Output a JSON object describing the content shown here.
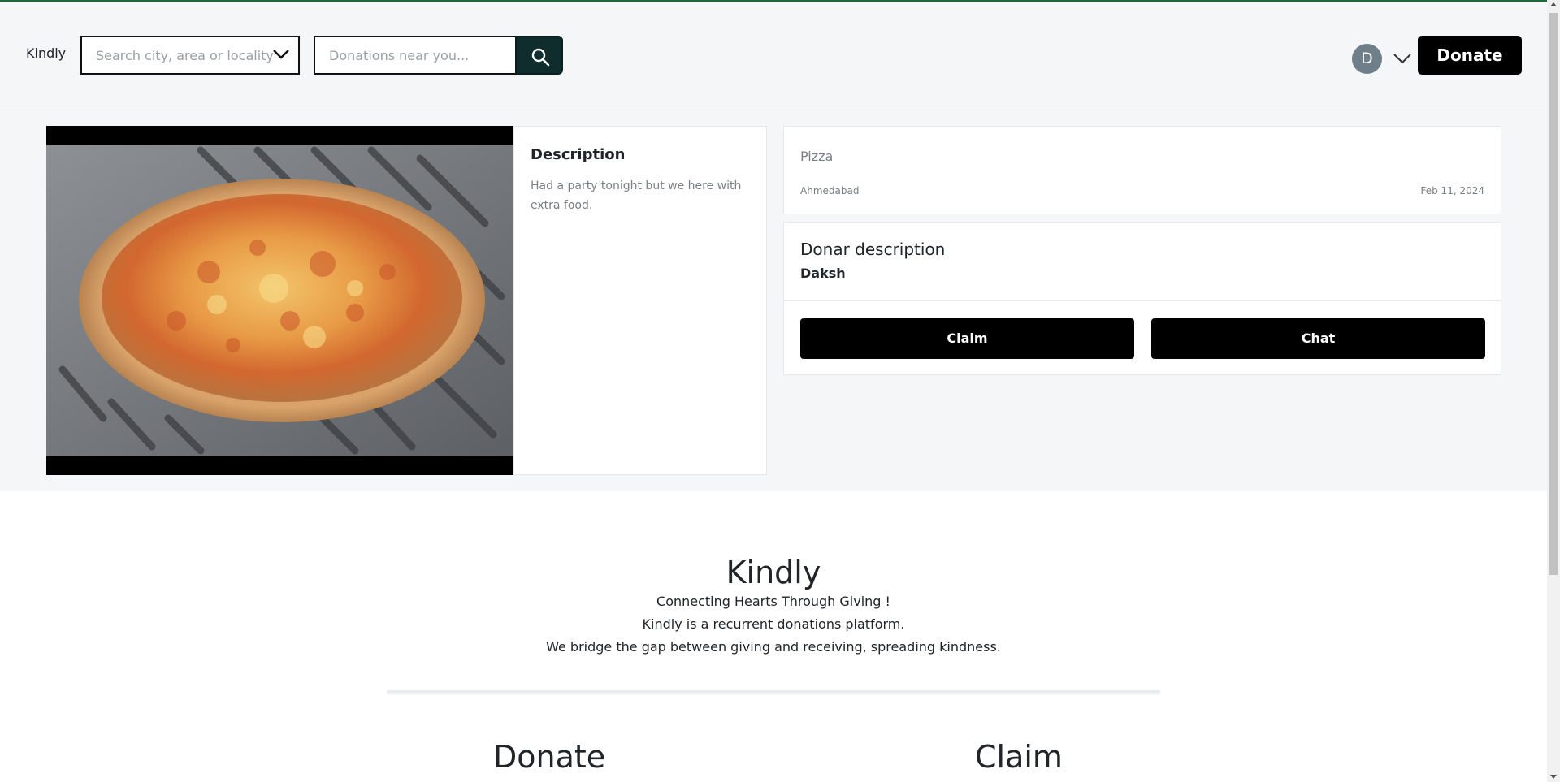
{
  "header": {
    "brand": "Kindly",
    "location_placeholder": "Search city, area or locality",
    "search_placeholder": "Donations near you...",
    "avatar_initial": "D",
    "donate_label": "Donate"
  },
  "listing": {
    "description_heading": "Description",
    "description_text": "Had a party tonight but we here with extra food.",
    "title": "Pizza",
    "city": "Ahmedabad",
    "date": "Feb 11, 2024",
    "donor_heading": "Donar description",
    "donor_name": "Daksh",
    "claim_label": "Claim",
    "chat_label": "Chat"
  },
  "footer": {
    "title": "Kindly",
    "tagline": "Connecting Hearts Through Giving !",
    "line2": "Kindly is a recurrent donations platform.",
    "line3": "We bridge the gap between giving and receiving, spreading kindness.",
    "section_donate": "Donate",
    "section_claim": "Claim"
  },
  "colors": {
    "search_button": "#0f2d2d",
    "primary_button": "#000000",
    "avatar": "#6f7f89",
    "page_band": "#f4f6f8"
  },
  "icons": [
    "chevron-down-icon",
    "search-icon",
    "user-chevron-icon"
  ]
}
